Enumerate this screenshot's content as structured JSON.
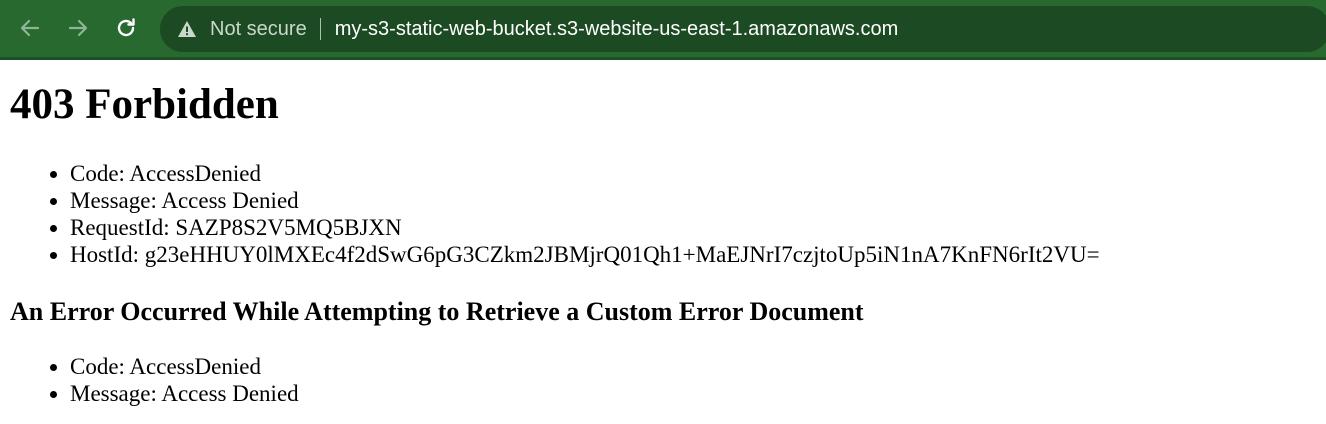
{
  "browser": {
    "security_label": "Not secure",
    "url": "my-s3-static-web-bucket.s3-website-us-east-1.amazonaws.com",
    "toolbar_color": "#27692f",
    "icons": [
      "back-arrow-icon",
      "forward-arrow-icon",
      "reload-icon",
      "warning-icon"
    ]
  },
  "page": {
    "title": "403 Forbidden",
    "error_details": [
      "Code: AccessDenied",
      "Message: Access Denied",
      "RequestId: SAZP8S2V5MQ5BJXN",
      "HostId: g23eHHUY0lMXEc4f2dSwG6pG3CZkm2JBMjrQ01Qh1+MaEJNrI7czjtoUp5iN1nA7KnFN6rIt2VU="
    ],
    "subheading": "An Error Occurred While Attempting to Retrieve a Custom Error Document",
    "secondary_details": [
      "Code: AccessDenied",
      "Message: Access Denied"
    ]
  }
}
